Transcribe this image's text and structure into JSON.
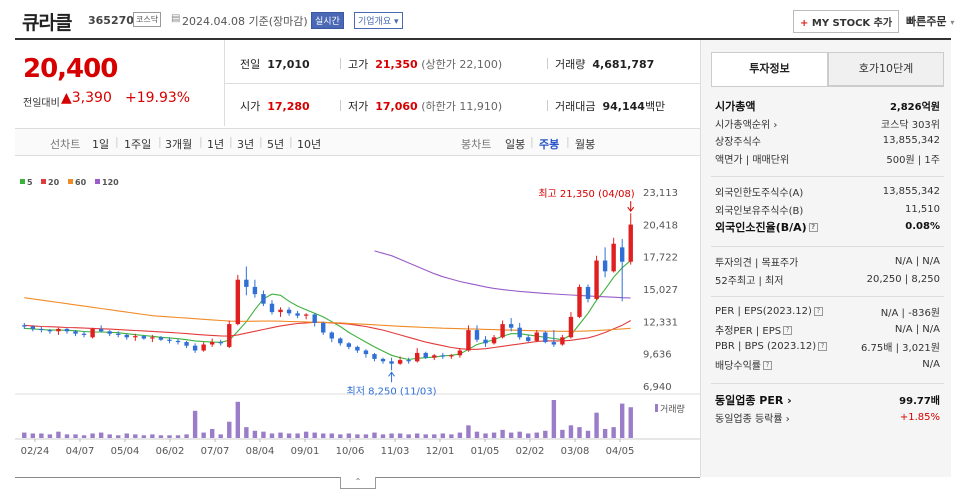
{
  "header": {
    "name": "큐라클",
    "code": "365270",
    "market": "코스닥",
    "date": "2024.04.08 기준(장마감)",
    "realtime": "실시간",
    "company": "기업개요",
    "mystock": "MY STOCK 추가",
    "mystock_plus": "+",
    "quick": "빠른주문"
  },
  "price": {
    "current": "20,400",
    "prev_label": "전일대비",
    "change": "▲3,390",
    "pct": "+19.93%"
  },
  "stats": {
    "prev_close_label": "전일",
    "prev_close": "17,010",
    "high_label": "고가",
    "high": "21,350",
    "upper_limit": "(상한가 22,100)",
    "volume_label": "거래량",
    "volume": "4,681,787",
    "open_label": "시가",
    "open": "17,280",
    "low_label": "저가",
    "low": "17,060",
    "lower_limit": "(하한가 11,910)",
    "amount_label": "거래대금",
    "amount": "94,144",
    "amount_unit": "백만"
  },
  "periods": {
    "line_label": "선차트",
    "line": [
      "1일",
      "1주일",
      "3개월",
      "1년",
      "3년",
      "5년",
      "10년"
    ],
    "candle_label": "봉차트",
    "candle": [
      "일봉",
      "주봉",
      "월봉"
    ],
    "active": "주봉"
  },
  "chart_data": {
    "type": "candlestick",
    "legend": [
      {
        "name": "5",
        "color": "#3cb23c"
      },
      {
        "name": "20",
        "color": "#e23b3b"
      },
      {
        "name": "60",
        "color": "#f08c28"
      },
      {
        "name": "120",
        "color": "#9a5cc8"
      }
    ],
    "yticks": [
      "23,113",
      "20,418",
      "17,722",
      "15,027",
      "12,331",
      "9,636",
      "6,940"
    ],
    "ylim": [
      6940,
      23113
    ],
    "xticks": [
      "02/24",
      "04/07",
      "05/04",
      "06/02",
      "07/07",
      "08/04",
      "09/01",
      "10/06",
      "11/03",
      "12/01",
      "01/05",
      "02/02",
      "03/08",
      "04/05"
    ],
    "high_annotation": "최고 21,350 (04/08)",
    "low_annotation": "최저 8,250 (11/03)",
    "volume_label": "거래량",
    "candles": [
      [
        12000,
        12200,
        11700,
        11900
      ],
      [
        11900,
        12000,
        11500,
        11700
      ],
      [
        11700,
        11900,
        11400,
        11600
      ],
      [
        11600,
        11700,
        11300,
        11500
      ],
      [
        11500,
        11800,
        11200,
        11700
      ],
      [
        11700,
        11800,
        11300,
        11500
      ],
      [
        11500,
        11600,
        11100,
        11300
      ],
      [
        11300,
        11500,
        11000,
        11200
      ],
      [
        11000,
        11800,
        10900,
        11700
      ],
      [
        11700,
        12000,
        11400,
        11500
      ],
      [
        11500,
        11600,
        11100,
        11300
      ],
      [
        11300,
        11500,
        11000,
        11200
      ],
      [
        11200,
        11300,
        10800,
        11000
      ],
      [
        11000,
        11300,
        10700,
        11100
      ],
      [
        11100,
        11200,
        10800,
        10900
      ],
      [
        10900,
        11200,
        10600,
        11000
      ],
      [
        11000,
        11100,
        10700,
        10800
      ],
      [
        10800,
        11000,
        10500,
        10700
      ],
      [
        10700,
        10900,
        10400,
        10600
      ],
      [
        10600,
        10700,
        10100,
        10300
      ],
      [
        10300,
        10500,
        9700,
        9900
      ],
      [
        9900,
        10600,
        9800,
        10400
      ],
      [
        10400,
        10900,
        10200,
        10600
      ],
      [
        10600,
        10800,
        10300,
        10500
      ],
      [
        10200,
        12400,
        10100,
        12100
      ],
      [
        12100,
        16200,
        12000,
        15800
      ],
      [
        15800,
        16900,
        14500,
        15200
      ],
      [
        15200,
        15800,
        14300,
        14600
      ],
      [
        14600,
        14900,
        13600,
        13800
      ],
      [
        13800,
        14100,
        12900,
        13100
      ],
      [
        13100,
        13500,
        12700,
        13300
      ],
      [
        13300,
        13500,
        12800,
        13000
      ],
      [
        13000,
        13200,
        12600,
        12800
      ],
      [
        12800,
        13000,
        12500,
        12900
      ],
      [
        12900,
        13000,
        11900,
        12200
      ],
      [
        12200,
        12300,
        11200,
        11400
      ],
      [
        11400,
        11500,
        10600,
        10900
      ],
      [
        10900,
        11000,
        10300,
        10500
      ],
      [
        10500,
        10600,
        10000,
        10200
      ],
      [
        10200,
        10300,
        9700,
        9900
      ],
      [
        9900,
        10000,
        9300,
        9600
      ],
      [
        9600,
        9700,
        9000,
        9200
      ],
      [
        9200,
        9300,
        8800,
        9000
      ],
      [
        9000,
        9300,
        8250,
        8800
      ],
      [
        8800,
        9400,
        8700,
        9100
      ],
      [
        9100,
        9300,
        8800,
        9000
      ],
      [
        9000,
        10100,
        8900,
        9700
      ],
      [
        9700,
        9800,
        9200,
        9300
      ],
      [
        9300,
        9600,
        9100,
        9500
      ],
      [
        9500,
        9700,
        9200,
        9400
      ],
      [
        9400,
        9600,
        9200,
        9500
      ],
      [
        9500,
        10100,
        9300,
        9900
      ],
      [
        9900,
        12000,
        9800,
        11600
      ],
      [
        11600,
        12000,
        10600,
        10800
      ],
      [
        10800,
        11100,
        10200,
        10500
      ],
      [
        10500,
        11200,
        10400,
        11000
      ],
      [
        11000,
        12400,
        10900,
        12100
      ],
      [
        12100,
        12600,
        11500,
        11800
      ],
      [
        11800,
        12200,
        10800,
        11000
      ],
      [
        11000,
        11200,
        10600,
        10700
      ],
      [
        10700,
        11600,
        10600,
        11400
      ],
      [
        11400,
        11500,
        10500,
        10600
      ],
      [
        10600,
        11600,
        10200,
        10400
      ],
      [
        10400,
        11200,
        10300,
        11000
      ],
      [
        11000,
        13100,
        10900,
        12700
      ],
      [
        12700,
        15400,
        12600,
        15200
      ],
      [
        15200,
        15400,
        13900,
        14200
      ],
      [
        14200,
        17800,
        14100,
        17400
      ],
      [
        17400,
        18500,
        16000,
        16500
      ],
      [
        16500,
        19300,
        16400,
        18800
      ],
      [
        18500,
        19200,
        14000,
        17300
      ],
      [
        17300,
        21350,
        17060,
        20400
      ]
    ],
    "volumes": [
      6,
      5,
      5,
      4,
      7,
      4,
      4,
      3,
      5,
      6,
      4,
      3,
      5,
      4,
      3,
      4,
      3,
      3,
      3,
      4,
      30,
      6,
      10,
      4,
      18,
      40,
      12,
      8,
      7,
      5,
      6,
      5,
      5,
      7,
      6,
      5,
      5,
      4,
      5,
      4,
      4,
      6,
      4,
      5,
      5,
      4,
      5,
      4,
      4,
      5,
      4,
      6,
      14,
      7,
      5,
      6,
      9,
      6,
      7,
      5,
      6,
      8,
      42,
      9,
      14,
      12,
      8,
      28,
      10,
      12,
      38,
      34
    ],
    "ma": {
      "5": [
        11750,
        11700,
        11650,
        11600,
        11600,
        11580,
        11550,
        11480,
        11450,
        11440,
        11420,
        11380,
        11300,
        11220,
        11150,
        11080,
        11000,
        10950,
        10880,
        10800,
        10700,
        10640,
        10600,
        10580,
        10750,
        11500,
        12300,
        13300,
        14200,
        14600,
        14500,
        14000,
        13600,
        13300,
        13000,
        12700,
        12300,
        11900,
        11400,
        11000,
        10600,
        10200,
        9850,
        9500,
        9300,
        9150,
        9250,
        9300,
        9350,
        9450,
        9500,
        9600,
        10000,
        10400,
        10600,
        10800,
        11100,
        11300,
        11300,
        11200,
        11100,
        11000,
        10900,
        10800,
        11200,
        12100,
        13000,
        14100,
        15000,
        16000,
        16800,
        17400
      ],
      "20": [
        12000,
        11950,
        11900,
        11880,
        11850,
        11820,
        11800,
        11770,
        11740,
        11710,
        11680,
        11640,
        11600,
        11570,
        11530,
        11490,
        11450,
        11410,
        11360,
        11310,
        11250,
        11200,
        11160,
        11120,
        11100,
        11200,
        11350,
        11500,
        11650,
        11800,
        11950,
        12050,
        12150,
        12200,
        12250,
        12250,
        12200,
        12150,
        12100,
        12000,
        11900,
        11750,
        11600,
        11400,
        11200,
        11000,
        10800,
        10600,
        10450,
        10300,
        10150,
        10050,
        10000,
        10000,
        10050,
        10150,
        10250,
        10350,
        10450,
        10550,
        10650,
        10700,
        10700,
        10700,
        10750,
        10850,
        10950,
        11150,
        11400,
        11700,
        12000,
        12400
      ],
      "60": [
        14300,
        14200,
        14100,
        14000,
        13900,
        13800,
        13700,
        13600,
        13500,
        13400,
        13300,
        13200,
        13100,
        13000,
        12900,
        12800,
        12750,
        12700,
        12650,
        12600,
        12550,
        12500,
        12450,
        12400,
        12350,
        12330,
        12330,
        12340,
        12350,
        12350,
        12340,
        12320,
        12300,
        12280,
        12260,
        12240,
        12220,
        12200,
        12160,
        12120,
        12080,
        12040,
        12000,
        11960,
        11920,
        11880,
        11850,
        11820,
        11790,
        11760,
        11740,
        11720,
        11700,
        11680,
        11660,
        11640,
        11620,
        11600,
        11580,
        11560,
        11540,
        11520,
        11510,
        11500,
        11500,
        11510,
        11530,
        11560,
        11600,
        11650,
        11700,
        11750
      ],
      "120": [
        null,
        null,
        null,
        null,
        null,
        null,
        null,
        null,
        null,
        null,
        null,
        null,
        null,
        null,
        null,
        null,
        null,
        null,
        null,
        null,
        null,
        null,
        null,
        null,
        null,
        null,
        null,
        null,
        null,
        null,
        null,
        null,
        null,
        null,
        null,
        null,
        null,
        null,
        null,
        null,
        null,
        18200,
        18000,
        17800,
        17500,
        17200,
        16900,
        16600,
        16300,
        16050,
        15850,
        15650,
        15500,
        15350,
        15200,
        15080,
        14980,
        14900,
        14830,
        14770,
        14710,
        14660,
        14610,
        14570,
        14530,
        14490,
        14450,
        14410,
        14380,
        14340,
        14300,
        14280
      ]
    }
  },
  "panel": {
    "tab_invest": "투자정보",
    "tab_hoga": "호가10단계",
    "rows_a": [
      {
        "k": "시가총액",
        "v": "2,826억원",
        "bold": true
      },
      {
        "k": "시가총액순위 ›",
        "v": "코스닥 303위"
      },
      {
        "k": "상장주식수",
        "v": "13,855,342"
      },
      {
        "k": "액면가 | 매매단위",
        "v": "500원 | 1주"
      }
    ],
    "rows_b": [
      {
        "k": "외국인한도주식수(A)",
        "v": "13,855,342"
      },
      {
        "k": "외국인보유주식수(B)",
        "v": "11,510"
      },
      {
        "k": "외국인소진율(B/A)",
        "v": "0.08%",
        "bold": true,
        "q": true
      }
    ],
    "rows_c": [
      {
        "k": "투자의견 | 목표주가",
        "v": "N/A | N/A"
      },
      {
        "k": "52주최고 | 최저",
        "v": "20,250 | 8,250"
      }
    ],
    "rows_d": [
      {
        "k": "PER | EPS(2023.12)",
        "v": "N/A | -836원",
        "q": true
      },
      {
        "k": "추정PER | EPS",
        "v": "N/A | N/A",
        "q": true
      },
      {
        "k": "PBR | BPS (2023.12)",
        "v": "6.75배 | 3,021원",
        "q": true
      },
      {
        "k": "배당수익률",
        "v": "N/A",
        "q": true
      }
    ],
    "rows_e": [
      {
        "k": "동일업종 PER ›",
        "v": "99.77배",
        "bold": true
      },
      {
        "k": "동일업종 등락률 ›",
        "v": "+1.85%",
        "red": true
      }
    ]
  }
}
